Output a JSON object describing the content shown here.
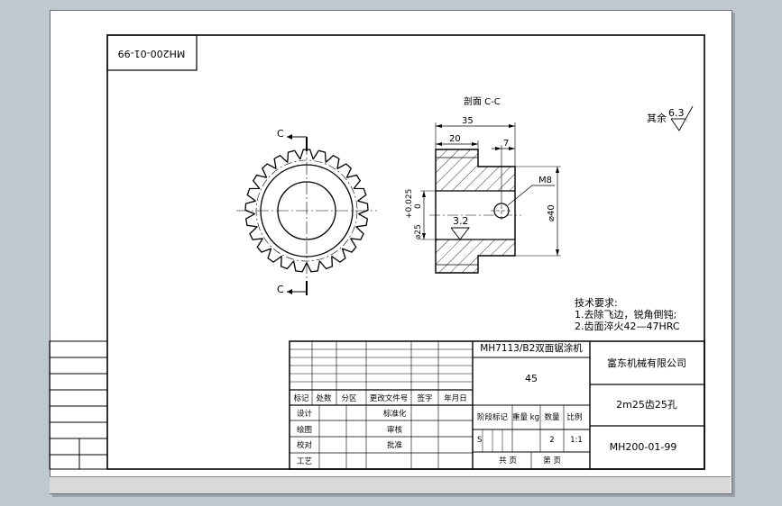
{
  "drawing": {
    "number_rotated": "MH200-01-99",
    "section_title": "剖面 C-C",
    "cut_label_top": "C",
    "cut_label_bottom": "C",
    "dims": {
      "overall_length": "35",
      "hub_length": "20",
      "keyway_offset": "7",
      "thread": "M8",
      "outer_dia": "⌀40",
      "bore_dia": "⌀25",
      "tol_upper": "+0.025",
      "tol_lower": "0"
    },
    "roughness_bore": "3.2",
    "roughness_other_label": "其余",
    "roughness_other_value": "6.3",
    "tech_req": {
      "title": "技术要求:",
      "item1": "1.去除飞边，锐角倒钝;",
      "item2": "2.齿面淬火42—47HRC"
    }
  },
  "title_block": {
    "part_name": "MH7113/B2双面锯涂机",
    "material": "45",
    "company": "富东机械有限公司",
    "drawing_title": "2m25齿25孔",
    "drawing_number": "MH200-01-99",
    "rev_headers": [
      "标记",
      "处数",
      "分区",
      "更改文件号",
      "签字",
      "年月日"
    ],
    "row_design": "设计",
    "row_standard": "标准化",
    "row_drafting": "绘图",
    "row_review": "审核",
    "row_check": "校对",
    "row_approve": "批准",
    "row_process": "工艺",
    "stage_label": "阶段标记",
    "weight_label": "重量 kg",
    "qty_label": "数量",
    "scale_label": "比例",
    "stage_value": "S",
    "qty_value": "2",
    "scale_value": "1:1",
    "total_sheets": "共 页",
    "sheet_no": "第 页"
  }
}
